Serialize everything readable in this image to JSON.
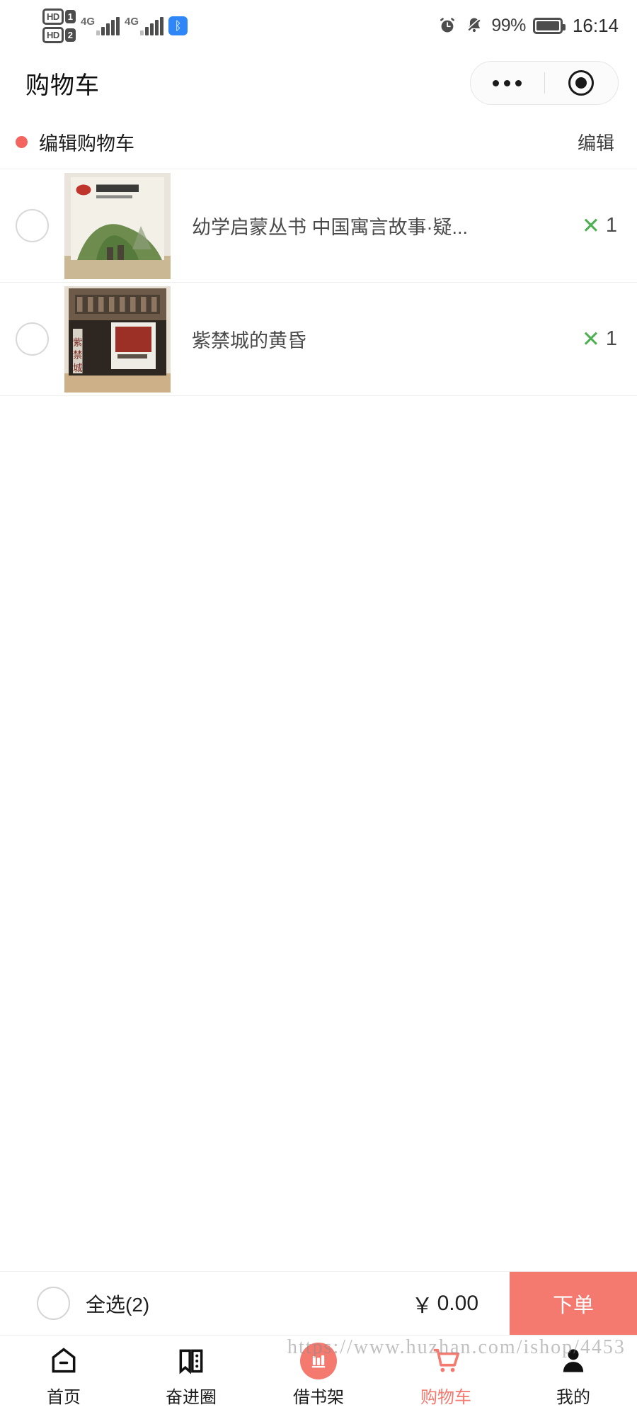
{
  "statusbar": {
    "hd1_label": "HD",
    "hd1_num": "1",
    "hd2_label": "HD",
    "hd2_num": "2",
    "net1": "4G",
    "net2": "4G",
    "bluetooth_icon": "bluetooth-icon",
    "alarm_icon": "alarm-clock-icon",
    "mute_icon": "bell-muted-icon",
    "battery_percent": "99%",
    "battery_icon": "battery-icon",
    "time": "16:14"
  },
  "navbar": {
    "title": "购物车",
    "capsule": {
      "more_icon": "more-dots-icon",
      "target_icon": "target-circle-icon"
    }
  },
  "editrow": {
    "dot_icon": "red-dot-icon",
    "label": "编辑购物车",
    "action": "编辑"
  },
  "cart": {
    "items": [
      {
        "checkbox_icon": "checkbox-unchecked-icon",
        "thumb_name": "book-cover-thumbnail",
        "title": "幼学启蒙丛书 中国寓言故事·疑...",
        "qty_mark": "✕",
        "qty": "1"
      },
      {
        "checkbox_icon": "checkbox-unchecked-icon",
        "thumb_name": "book-cover-thumbnail",
        "title": "紫禁城的黄昏",
        "qty_mark": "✕",
        "qty": "1"
      }
    ]
  },
  "checkout": {
    "select_all_checkbox": "checkbox-unchecked-icon",
    "select_all_label": "全选(2)",
    "currency": "￥",
    "total": "0.00",
    "order_button": "下单"
  },
  "tabbar": {
    "items": [
      {
        "icon": "home-icon",
        "label": "首页",
        "active": false
      },
      {
        "icon": "book-open-icon",
        "label": "奋进圈",
        "active": false
      },
      {
        "icon": "bookshelf-icon",
        "label": "借书架",
        "active": false
      },
      {
        "icon": "cart-icon",
        "label": "购物车",
        "active": true
      },
      {
        "icon": "person-icon",
        "label": "我的",
        "active": false
      }
    ]
  },
  "watermark": {
    "text": "https://www.huzhan.com/ishop/4453"
  },
  "colors": {
    "accent": "#f4796f",
    "qty_green": "#4caf50",
    "text_primary": "#1c1c1c",
    "text_secondary": "#4a4a4a",
    "bluetooth_blue": "#2f86f6"
  }
}
